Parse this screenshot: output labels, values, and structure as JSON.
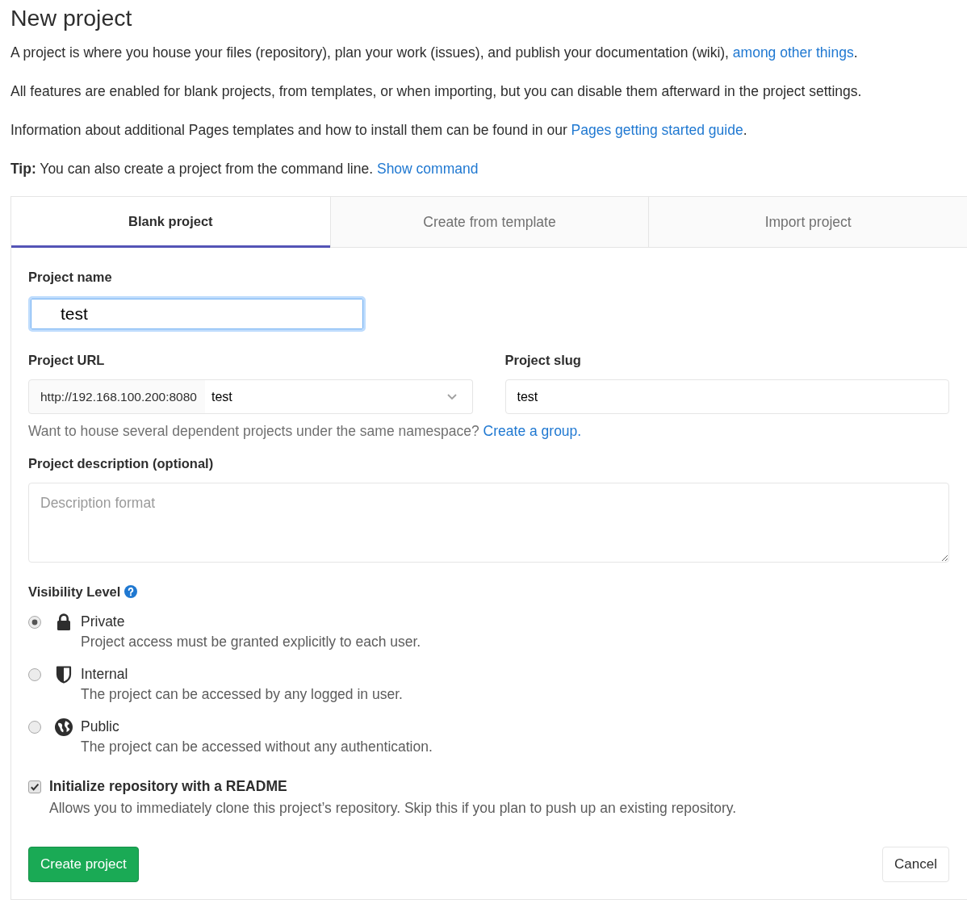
{
  "page": {
    "title": "New project"
  },
  "intro": [
    {
      "parts": [
        {
          "kind": "text",
          "text": "A project is where you house your files (repository), plan your work (issues), and publish your documentation (wiki), "
        },
        {
          "kind": "link",
          "text": "among other things"
        },
        {
          "kind": "text",
          "text": "."
        }
      ]
    },
    {
      "parts": [
        {
          "kind": "text",
          "text": "All features are enabled for blank projects, from templates, or when importing, but you can disable them afterward in the project settings."
        }
      ]
    },
    {
      "parts": [
        {
          "kind": "text",
          "text": "Information about additional Pages templates and how to install them can be found in our "
        },
        {
          "kind": "link",
          "text": "Pages getting started guide"
        },
        {
          "kind": "text",
          "text": "."
        }
      ]
    },
    {
      "parts": [
        {
          "kind": "text",
          "text": "**Tip:** You can also create a project from the command line. "
        },
        {
          "kind": "link",
          "text": "Show command"
        }
      ]
    }
  ],
  "tabs": [
    {
      "label": "Blank project",
      "selected": true
    },
    {
      "label": "Create from template",
      "selected": false
    },
    {
      "label": "Import project",
      "selected": false
    }
  ],
  "form": {
    "project_name": {
      "label": "Project name",
      "value": "test",
      "focused": true
    },
    "project_url": {
      "label": "Project URL",
      "prefix": "http://192.168.100.200:8080",
      "namespace": "test"
    },
    "project_slug": {
      "label": "Project slug",
      "value": "test"
    },
    "url_help": {
      "text": "Want to house several dependent projects under the same namespace? ",
      "link": "Create a group."
    },
    "description": {
      "label": "Project description (optional)",
      "placeholder": "Description format"
    },
    "visibility": {
      "label": "Visibility Level",
      "options": [
        {
          "label": "Private",
          "description": "Project access must be granted explicitly to each user.",
          "selected": true
        },
        {
          "label": "Internal",
          "description": "The project can be accessed by any logged in user.",
          "selected": false
        },
        {
          "label": "Public",
          "description": "The project can be accessed without any authentication.",
          "selected": false
        }
      ]
    },
    "readme": {
      "label": "Initialize repository with a README",
      "help": "Allows you to immediately clone this project’s repository. Skip this if you plan to push up an existing repository.",
      "checked": true
    },
    "buttons": [
      {
        "label": "Create project",
        "kind": "primary"
      },
      {
        "label": "Cancel",
        "kind": "secondary"
      }
    ]
  }
}
